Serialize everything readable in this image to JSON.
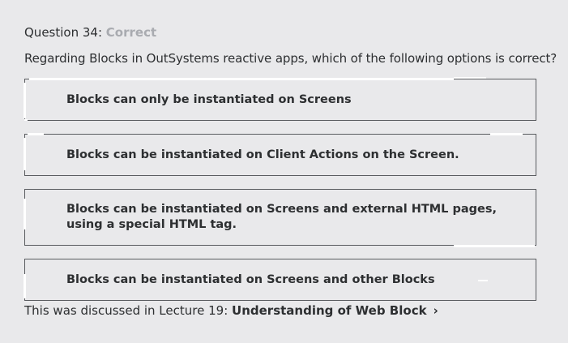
{
  "question": {
    "prefix": "Question 34:",
    "status": "Correct",
    "text": "Regarding Blocks in OutSystems reactive apps, which of the following options is correct?"
  },
  "options": [
    {
      "label": "Blocks can only be instantiated on Screens"
    },
    {
      "label": "Blocks can be instantiated on Client Actions on the Screen."
    },
    {
      "label": "Blocks can be instantiated on Screens and external HTML pages, using a special HTML tag."
    },
    {
      "label": "Blocks can be instantiated on Screens and other Blocks"
    }
  ],
  "footer": {
    "prefix": "This was discussed in Lecture 19:",
    "link_label": "Understanding of Web Block",
    "chevron": "›"
  },
  "colors": {
    "background": "#e9e9eb",
    "text": "#2d2f31",
    "status_correct": "#a9abb0",
    "border": "#5a5c60"
  }
}
